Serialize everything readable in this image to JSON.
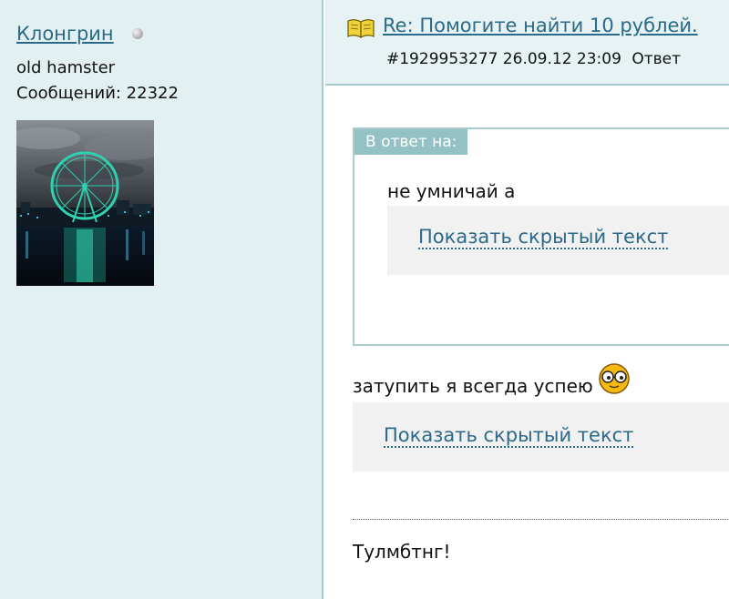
{
  "user": {
    "name": "Клонгрин",
    "title": "old hamster",
    "posts": "Сообщений: 22322"
  },
  "post": {
    "title": "Re: Помогите найти 10 рублей.",
    "id_date": "#1929953277 26.09.12 23:09",
    "reply_label": "Ответ"
  },
  "quote": {
    "label": "В ответ на:",
    "text": "не умничай а",
    "spoiler_label": "Показать скрытый текст"
  },
  "message": {
    "text": "затупить я всегда успею",
    "spoiler_label": "Показать скрытый текст",
    "signature": "Тулмбтнг!"
  },
  "colors": {
    "link": "#2b6a88",
    "panel_bg": "#e3f0f1",
    "border": "#a9cbce",
    "quote_label_bg": "#93c1c4"
  },
  "icons": {
    "online_status": "status-dot-icon",
    "post": "book-icon",
    "smiley": "nerd-smiley-icon"
  }
}
